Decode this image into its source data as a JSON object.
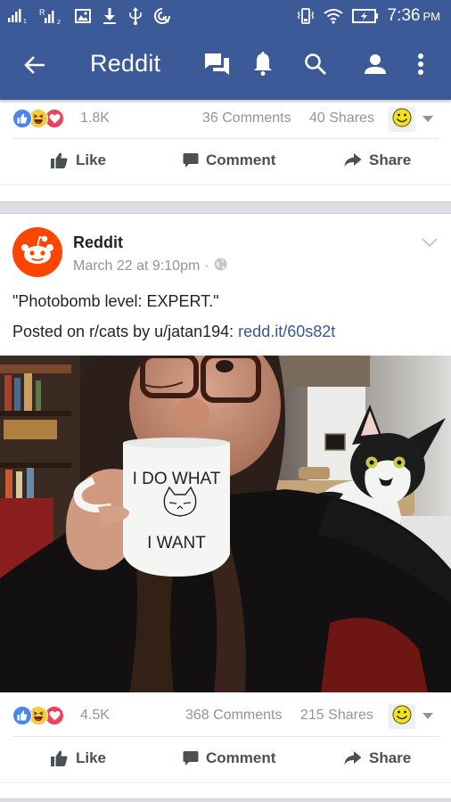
{
  "status_bar": {
    "time": "7:36",
    "ampm": "PM",
    "left_icons": [
      "signal-sim1-icon",
      "signal-sim2-roaming-icon",
      "image-notification-icon",
      "download-icon",
      "usb-icon",
      "hotspot-icon"
    ],
    "right_icons": [
      "vibrate-icon",
      "wifi-icon",
      "battery-charging-icon"
    ]
  },
  "app_bar": {
    "title": "Reddit",
    "icons": [
      "back-arrow-icon",
      "messenger-icon",
      "notifications-bell-icon",
      "search-icon",
      "profile-icon",
      "more-vert-icon"
    ]
  },
  "posts": [
    {
      "reaction_count": "1.8K",
      "reactions": [
        "like",
        "haha",
        "love"
      ],
      "comments": "36 Comments",
      "shares": "40 Shares",
      "actions": {
        "like": "Like",
        "comment": "Comment",
        "share": "Share"
      }
    },
    {
      "author": "Reddit",
      "timestamp": "March 22 at 9:10pm",
      "separator": "·",
      "privacy": "public",
      "text_line1": "\"Photobomb level: EXPERT.\"",
      "text_line2_prefix": "Posted on r/cats by u/jatan194: ",
      "link": "redd.it/60s82t",
      "photo": {
        "description": "Woman with glasses sipping from a white mug while a black-and-white cat photobombs from behind her shoulder",
        "mug_text_top": "I DO WHAT",
        "mug_text_bottom": "I WANT"
      },
      "reaction_count": "4.5K",
      "reactions": [
        "like",
        "haha",
        "love"
      ],
      "comments": "368 Comments",
      "shares": "215 Shares",
      "actions": {
        "like": "Like",
        "comment": "Comment",
        "share": "Share"
      }
    }
  ],
  "colors": {
    "brand_blue": "#3d5a98",
    "reddit_orange": "#ff4500",
    "link_blue": "#365899",
    "meta_gray": "#90949c",
    "action_gray": "#4b4f56"
  }
}
